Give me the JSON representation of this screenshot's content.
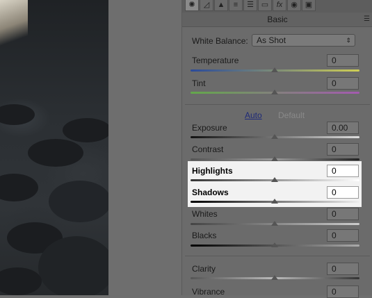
{
  "panel": {
    "title": "Basic",
    "menu_icon": "☰"
  },
  "toolbar": {
    "icons": [
      "aperture-icon",
      "tone-curve-icon",
      "detail-icon",
      "hsl-icon",
      "split-toning-icon",
      "lens-icon",
      "fx-icon",
      "camera-calibration-icon",
      "presets-icon"
    ]
  },
  "white_balance": {
    "label": "White Balance:",
    "value": "As Shot"
  },
  "wb_sliders": [
    {
      "label": "Temperature",
      "value": "0",
      "track": "temperature"
    },
    {
      "label": "Tint",
      "value": "0",
      "track": "tint"
    }
  ],
  "tone_links": {
    "auto": "Auto",
    "default": "Default"
  },
  "tone_sliders": [
    {
      "label": "Exposure",
      "value": "0.00"
    },
    {
      "label": "Contrast",
      "value": "0"
    },
    {
      "label": "Highlights",
      "value": "0"
    },
    {
      "label": "Shadows",
      "value": "0"
    },
    {
      "label": "Whites",
      "value": "0"
    },
    {
      "label": "Blacks",
      "value": "0"
    }
  ],
  "presence_sliders": [
    {
      "label": "Clarity",
      "value": "0"
    },
    {
      "label": "Vibrance",
      "value": "0"
    }
  ]
}
